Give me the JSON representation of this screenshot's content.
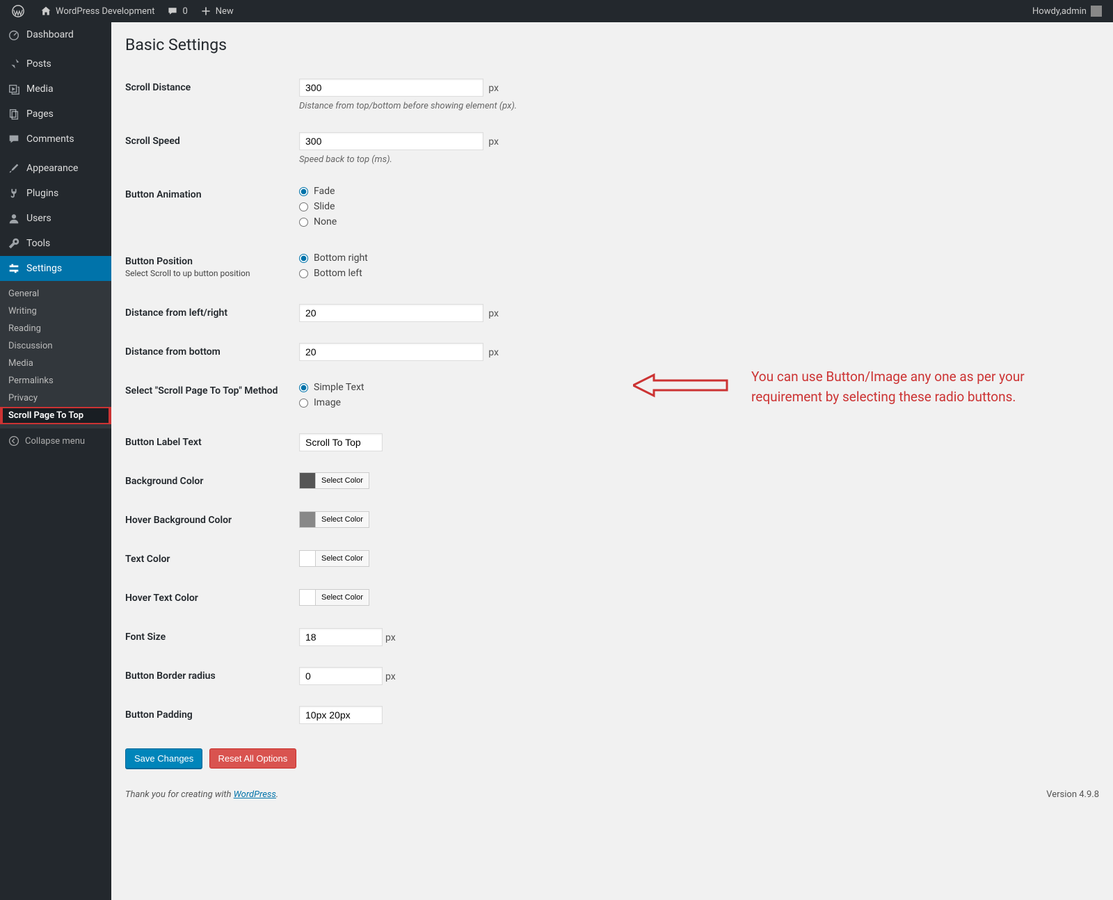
{
  "adminbar": {
    "site_name": "WordPress Development",
    "comments_count": "0",
    "new_label": "New",
    "howdy_prefix": "Howdy, ",
    "user": "admin"
  },
  "sidebar": {
    "items": [
      {
        "label": "Dashboard",
        "icon": "gauge"
      },
      {
        "label": "Posts",
        "icon": "pin"
      },
      {
        "label": "Media",
        "icon": "media"
      },
      {
        "label": "Pages",
        "icon": "pages"
      },
      {
        "label": "Comments",
        "icon": "comment"
      },
      {
        "label": "Appearance",
        "icon": "brush"
      },
      {
        "label": "Plugins",
        "icon": "plug"
      },
      {
        "label": "Users",
        "icon": "user"
      },
      {
        "label": "Tools",
        "icon": "wrench"
      },
      {
        "label": "Settings",
        "icon": "gear",
        "highlight": true
      }
    ],
    "submenu": [
      "General",
      "Writing",
      "Reading",
      "Discussion",
      "Media",
      "Permalinks",
      "Privacy",
      "Scroll Page To Top"
    ],
    "submenu_current_index": 7,
    "collapse_label": "Collapse menu"
  },
  "page": {
    "title": "Basic Settings",
    "fields": {
      "scroll_distance": {
        "label": "Scroll Distance",
        "value": "300",
        "unit": "px",
        "description": "Distance from top/bottom before showing element (px)."
      },
      "scroll_speed": {
        "label": "Scroll Speed",
        "value": "300",
        "unit": "px",
        "description": "Speed back to top (ms)."
      },
      "button_animation": {
        "label": "Button Animation",
        "options": [
          "Fade",
          "Slide",
          "None"
        ],
        "selected": 0
      },
      "button_position": {
        "label": "Button Position",
        "sublabel": "Select Scroll to up button position",
        "options": [
          "Bottom right",
          "Bottom left"
        ],
        "selected": 0
      },
      "distance_lr": {
        "label": "Distance from left/right",
        "value": "20",
        "unit": "px"
      },
      "distance_bottom": {
        "label": "Distance from bottom",
        "value": "20",
        "unit": "px"
      },
      "method": {
        "label": "Select \"Scroll Page To Top\" Method",
        "options": [
          "Simple Text",
          "Image"
        ],
        "selected": 0
      },
      "button_label_text": {
        "label": "Button Label Text",
        "value": "Scroll To Top"
      },
      "bg_color": {
        "label": "Background Color",
        "value": "#555555",
        "select_label": "Select Color"
      },
      "hover_bg_color": {
        "label": "Hover Background Color",
        "value": "#888888",
        "select_label": "Select Color"
      },
      "text_color": {
        "label": "Text Color",
        "value": "#ffffff",
        "select_label": "Select Color"
      },
      "hover_text_color": {
        "label": "Hover Text Color",
        "value": "#ffffff",
        "select_label": "Select Color"
      },
      "font_size": {
        "label": "Font Size",
        "value": "18",
        "unit": "px"
      },
      "border_radius": {
        "label": "Button Border radius",
        "value": "0",
        "unit": "px"
      },
      "padding": {
        "label": "Button Padding",
        "value": "10px 20px"
      }
    },
    "actions": {
      "save": "Save Changes",
      "reset": "Reset All Options"
    },
    "annotation": "You can use Button/Image any one as per your requirement by selecting these radio buttons."
  },
  "footer": {
    "thank_prefix": "Thank you for creating with ",
    "wp_link": "WordPress",
    "thank_suffix": ".",
    "version": "Version 4.9.8"
  }
}
